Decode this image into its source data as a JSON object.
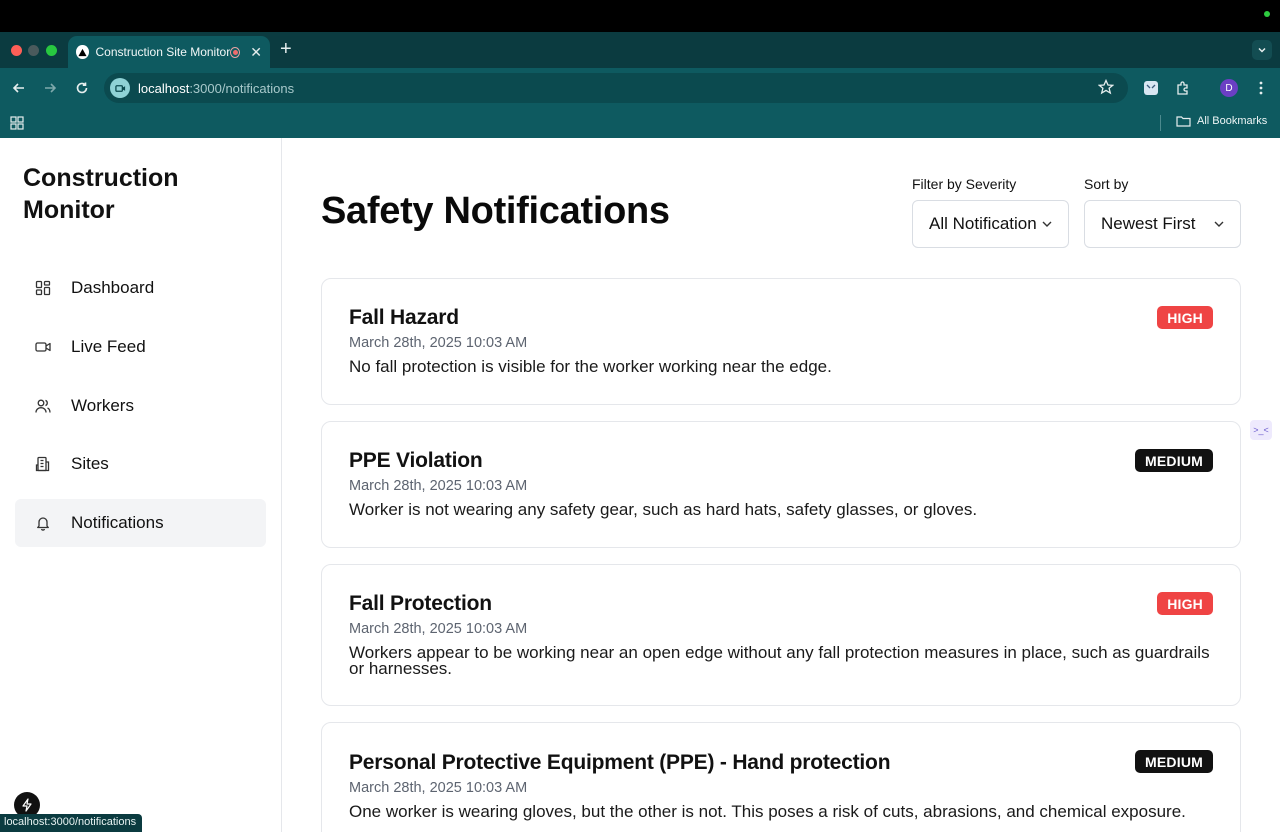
{
  "browser": {
    "tab_title": "Construction Site Monitor",
    "url_host": "localhost",
    "url_path": ":3000/notifications",
    "profile_initial": "D",
    "bookmarks_label": "All Bookmarks",
    "status_url": "localhost:3000/notifications"
  },
  "sidebar": {
    "brand": "Construction Monitor",
    "items": [
      {
        "label": "Dashboard",
        "icon": "dashboard-icon"
      },
      {
        "label": "Live Feed",
        "icon": "video-icon"
      },
      {
        "label": "Workers",
        "icon": "users-icon"
      },
      {
        "label": "Sites",
        "icon": "building-icon"
      },
      {
        "label": "Notifications",
        "icon": "bell-icon",
        "active": true
      }
    ]
  },
  "main": {
    "title": "Safety Notifications",
    "filter": {
      "label": "Filter by Severity",
      "value": "All Notifications"
    },
    "sort": {
      "label": "Sort by",
      "value": "Newest First"
    },
    "notifications": [
      {
        "title": "Fall Hazard",
        "time": "March 28th, 2025 10:03 AM",
        "description": "No fall protection is visible for the worker working near the edge.",
        "severity": "HIGH"
      },
      {
        "title": "PPE Violation",
        "time": "March 28th, 2025 10:03 AM",
        "description": "Worker is not wearing any safety gear, such as hard hats, safety glasses, or gloves.",
        "severity": "MEDIUM"
      },
      {
        "title": "Fall Protection",
        "time": "March 28th, 2025 10:03 AM",
        "description": "Workers appear to be working near an open edge without any fall protection measures in place, such as guardrails or harnesses.",
        "severity": "HIGH"
      },
      {
        "title": "Personal Protective Equipment (PPE) - Hand protection",
        "time": "March 28th, 2025 10:03 AM",
        "description": "One worker is wearing gloves, but the other is not. This poses a risk of cuts, abrasions, and chemical exposure.",
        "severity": "MEDIUM"
      }
    ]
  },
  "colors": {
    "chrome": "#0e5a60",
    "high": "#ef4444",
    "medium": "#111111"
  }
}
